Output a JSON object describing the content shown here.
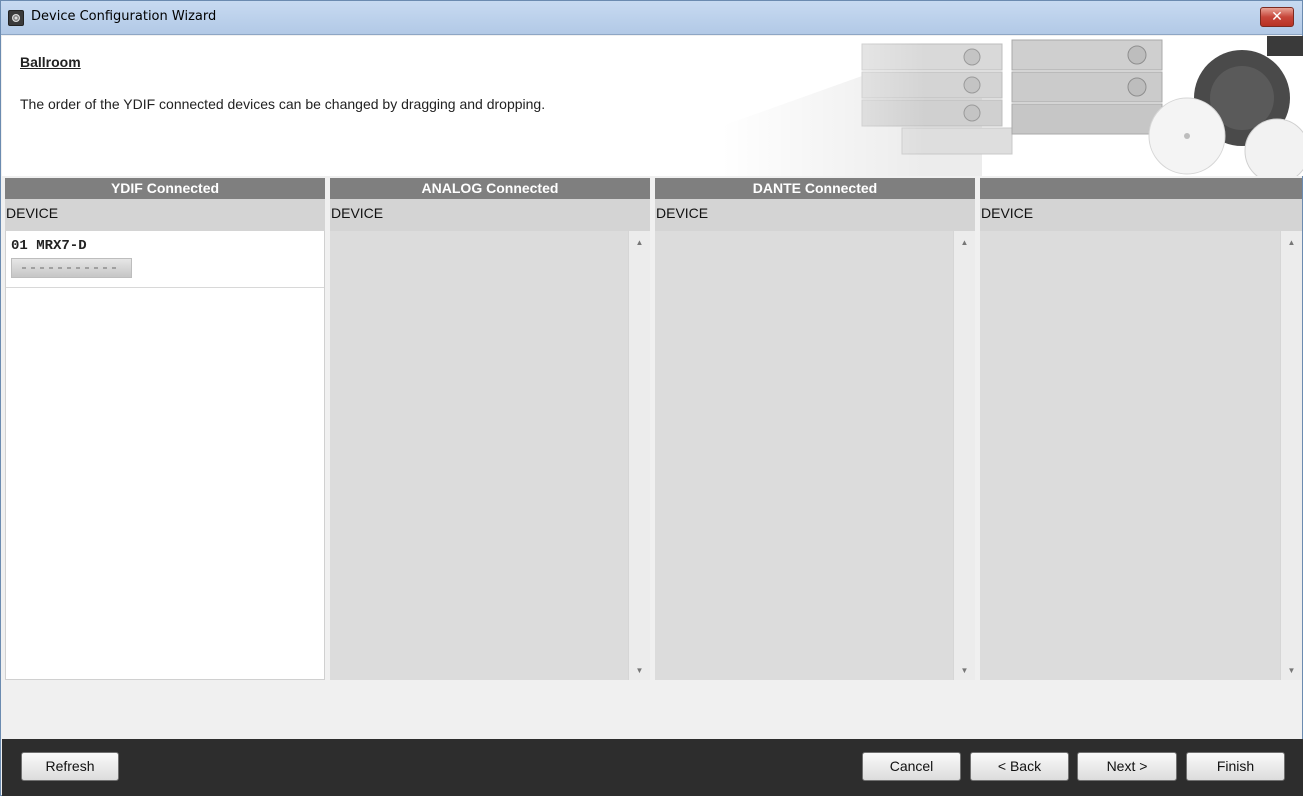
{
  "window": {
    "title": "Device Configuration Wizard",
    "close_glyph": "✕"
  },
  "header": {
    "page_title": "Ballroom",
    "instruction": "The order of the YDIF connected devices can be changed by dragging and dropping."
  },
  "columns": [
    {
      "heading": "YDIF Connected",
      "subheading": "DEVICE",
      "devices": [
        {
          "label": "01 MRX7-D"
        }
      ]
    },
    {
      "heading": "ANALOG Connected",
      "subheading": "DEVICE",
      "devices": []
    },
    {
      "heading": "DANTE Connected",
      "subheading": "DEVICE",
      "devices": []
    },
    {
      "heading": "",
      "subheading": "DEVICE",
      "devices": []
    }
  ],
  "footer": {
    "refresh_label": "Refresh",
    "cancel_label": "Cancel",
    "back_label": "< Back",
    "next_label": "Next >",
    "finish_label": "Finish"
  },
  "icons": {
    "app": "app-icon",
    "close": "close-icon",
    "scroll_up": "scroll-up-arrow-icon",
    "scroll_down": "scroll-down-arrow-icon"
  },
  "colors": {
    "column_header": "#7f7f7f",
    "footer": "#2d2d2d",
    "close_button": "#c7463a"
  }
}
